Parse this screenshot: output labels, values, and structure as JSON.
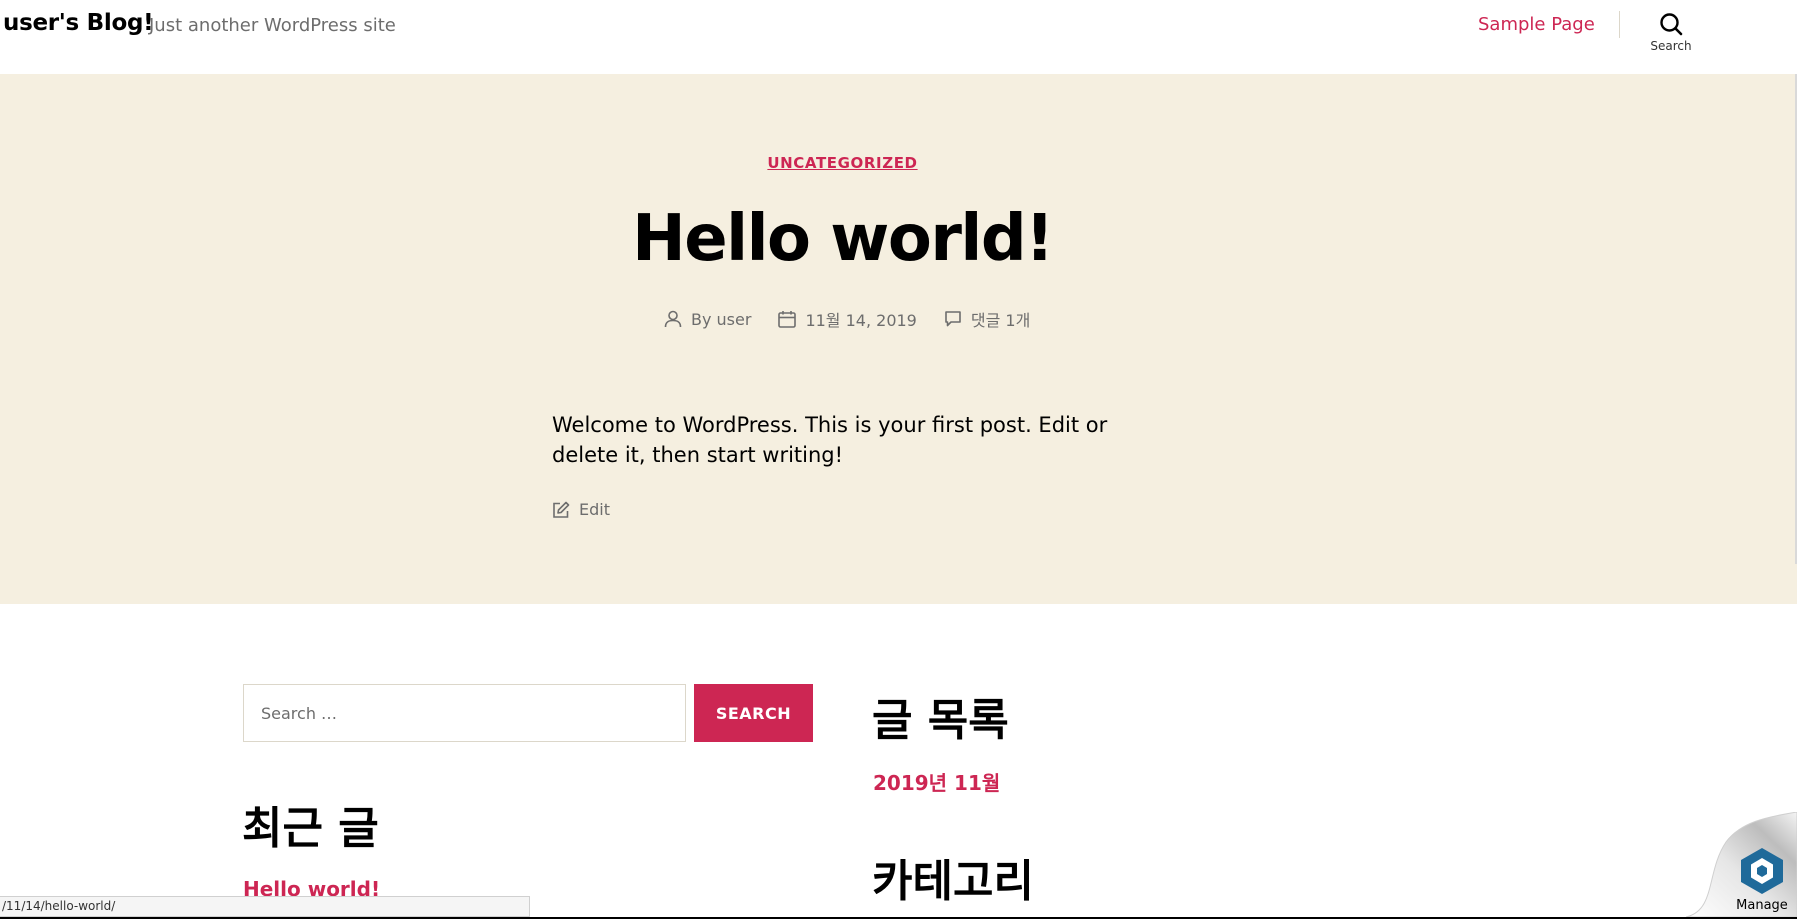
{
  "header": {
    "site_title": "user's Blog!",
    "site_description": "Just another WordPress site",
    "nav": [
      {
        "label": "Sample Page"
      }
    ],
    "search_toggle_label": "Search"
  },
  "post": {
    "category": "UNCATEGORIZED",
    "title": "Hello world!",
    "meta": {
      "author": "By user",
      "date": "11월 14, 2019",
      "comments": "댓글 1개"
    },
    "excerpt": "Welcome to WordPress. This is your first post. Edit or delete it, then start writing!",
    "edit_label": "Edit"
  },
  "widgets": {
    "search": {
      "placeholder": "Search …",
      "button_label": "SEARCH"
    },
    "recent": {
      "title": "최근 글",
      "items": [
        "Hello world!"
      ]
    },
    "archives": {
      "title": "글 목록",
      "items": [
        "2019년 11월"
      ]
    },
    "categories": {
      "title": "카테고리"
    }
  },
  "status_bar": {
    "url": "/11/14/hello-world/"
  },
  "manage": {
    "label": "Manage"
  },
  "colors": {
    "accent": "#cd2653",
    "hero_bg": "#f5efe0",
    "muted_text": "#6d6d6d"
  }
}
